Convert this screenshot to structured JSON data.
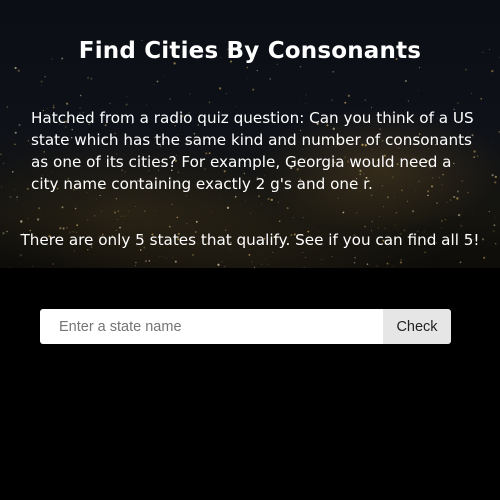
{
  "header": {
    "title": "Find Cities By Consonants",
    "description": "Hatched from a radio quiz question: Can you think of a US state which has the same kind and number of consonants as one of its cities? For example, Georgia would need a city name containing exactly 2 g's and one r.",
    "note": "There are only 5 states that qualify. See if you can find all 5!"
  },
  "search": {
    "placeholder": "Enter a state name",
    "value": "",
    "button_label": "Check"
  },
  "colors": {
    "page_background": "#000000",
    "text": "#ffffff",
    "button_background": "#e6e6e6"
  }
}
